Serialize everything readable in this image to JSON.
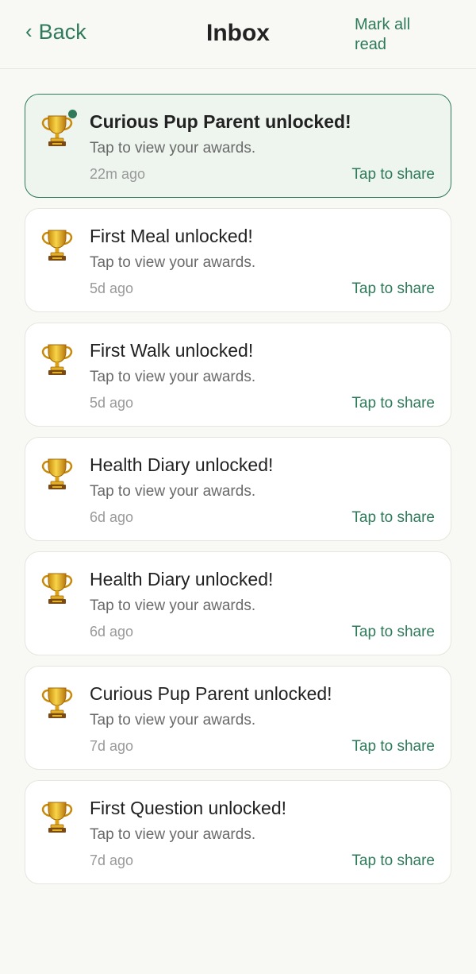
{
  "header": {
    "back_label": "Back",
    "title": "Inbox",
    "mark_all_label": "Mark all read"
  },
  "colors": {
    "accent": "#2e7a5a",
    "unread_background": "#eef5ef",
    "page_background": "#f8f8f4"
  },
  "notifications": [
    {
      "icon": "trophy-icon",
      "title": "Curious Pup Parent unlocked!",
      "subtitle": "Tap to view your awards.",
      "time": "22m ago",
      "share_label": "Tap to share",
      "unread": true
    },
    {
      "icon": "trophy-icon",
      "title": "First Meal unlocked!",
      "subtitle": "Tap to view your awards.",
      "time": "5d ago",
      "share_label": "Tap to share",
      "unread": false
    },
    {
      "icon": "trophy-icon",
      "title": "First Walk unlocked!",
      "subtitle": "Tap to view your awards.",
      "time": "5d ago",
      "share_label": "Tap to share",
      "unread": false
    },
    {
      "icon": "trophy-icon",
      "title": "Health Diary unlocked!",
      "subtitle": "Tap to view your awards.",
      "time": "6d ago",
      "share_label": "Tap to share",
      "unread": false
    },
    {
      "icon": "trophy-icon",
      "title": "Health Diary unlocked!",
      "subtitle": "Tap to view your awards.",
      "time": "6d ago",
      "share_label": "Tap to share",
      "unread": false
    },
    {
      "icon": "trophy-icon",
      "title": "Curious Pup Parent unlocked!",
      "subtitle": "Tap to view your awards.",
      "time": "7d ago",
      "share_label": "Tap to share",
      "unread": false
    },
    {
      "icon": "trophy-icon",
      "title": "First Question unlocked!",
      "subtitle": "Tap to view your awards.",
      "time": "7d ago",
      "share_label": "Tap to share",
      "unread": false
    }
  ]
}
